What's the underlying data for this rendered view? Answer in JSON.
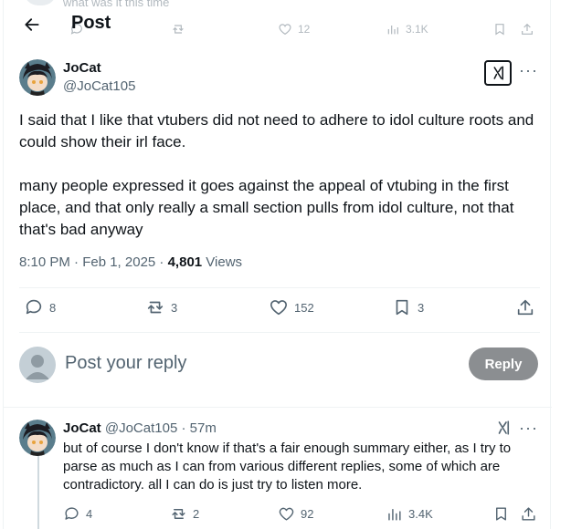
{
  "ghost": {
    "text": "what was it this time",
    "stats": {
      "likes": "12",
      "views": "3.1K"
    }
  },
  "header": {
    "title": "Post",
    "back_icon": "arrow-left-icon"
  },
  "tweet": {
    "author_name": "JoCat",
    "author_handle": "@JoCat105",
    "paragraph1": "I said that I like that vtubers did not need to adhere to idol culture roots and could show their irl face.",
    "paragraph2": "many people expressed it goes against the appeal of vtubing in the first place, and that only really a small section pulls from idol culture, not that that's bad anyway",
    "timestamp": "8:10 PM · Feb 1, 2025 · ",
    "views_count": "4,801",
    "views_label": " Views",
    "replies": "8",
    "reposts": "3",
    "likes": "152",
    "bookmarks": "3"
  },
  "reply_box": {
    "placeholder": "Post your reply",
    "button": "Reply"
  },
  "reply": {
    "author_name": "JoCat",
    "author_handle": "@JoCat105",
    "time": " · 57m",
    "text": "but of course I don't know if that's a fair enough summary either, as I try to parse as much as I can from various different replies, some of which are contradictory. all I can do is just try to listen more.",
    "replies": "4",
    "reposts": "2",
    "likes": "92",
    "views": "3.4K"
  },
  "colors": {
    "text": "#0f1419",
    "secondary": "#536471",
    "border": "#eff3f4",
    "reply_button": "#8b8e91"
  }
}
